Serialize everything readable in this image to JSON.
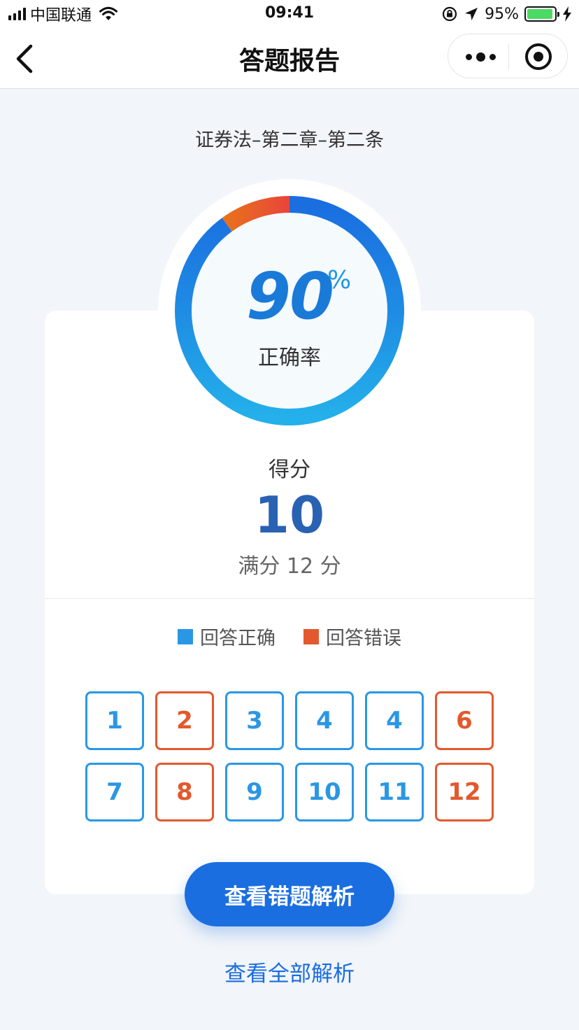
{
  "status_bar": {
    "carrier": "中国联通",
    "time": "09:41",
    "battery_percent": "95%",
    "battery_level": 0.95,
    "icons": [
      "signal-icon",
      "wifi-icon",
      "orientation-lock-icon",
      "location-arrow-icon",
      "battery-icon",
      "charging-bolt-icon"
    ]
  },
  "nav": {
    "title": "答题报告",
    "back_icon": "chevron-left-icon",
    "more_icon": "more-dots-icon",
    "close_icon": "target-close-icon"
  },
  "report": {
    "subtitle": "证券法–第二章–第二条",
    "accuracy_value": "90",
    "accuracy_sign": "%",
    "accuracy_label": "正确率",
    "accuracy_fraction": 0.9,
    "score_label": "得分",
    "score_value": "10",
    "score_total": "满分 12 分"
  },
  "legend": {
    "correct_label": "回答正确",
    "wrong_label": "回答错误",
    "correct_color": "#2a97e4",
    "wrong_color": "#e2592e"
  },
  "questions": [
    {
      "label": "1",
      "status": "correct"
    },
    {
      "label": "2",
      "status": "wrong"
    },
    {
      "label": "3",
      "status": "correct"
    },
    {
      "label": "4",
      "status": "correct"
    },
    {
      "label": "4",
      "status": "correct"
    },
    {
      "label": "6",
      "status": "wrong"
    },
    {
      "label": "7",
      "status": "correct"
    },
    {
      "label": "8",
      "status": "wrong"
    },
    {
      "label": "9",
      "status": "correct"
    },
    {
      "label": "10",
      "status": "correct"
    },
    {
      "label": "11",
      "status": "correct"
    },
    {
      "label": "12",
      "status": "wrong"
    }
  ],
  "actions": {
    "view_wrong_label": "查看错题解析",
    "view_all_label": "查看全部解析"
  },
  "colors": {
    "accent_blue": "#1a6ee0",
    "score_blue": "#2a62b3",
    "ring_wrong_orange": "#e8502a"
  }
}
